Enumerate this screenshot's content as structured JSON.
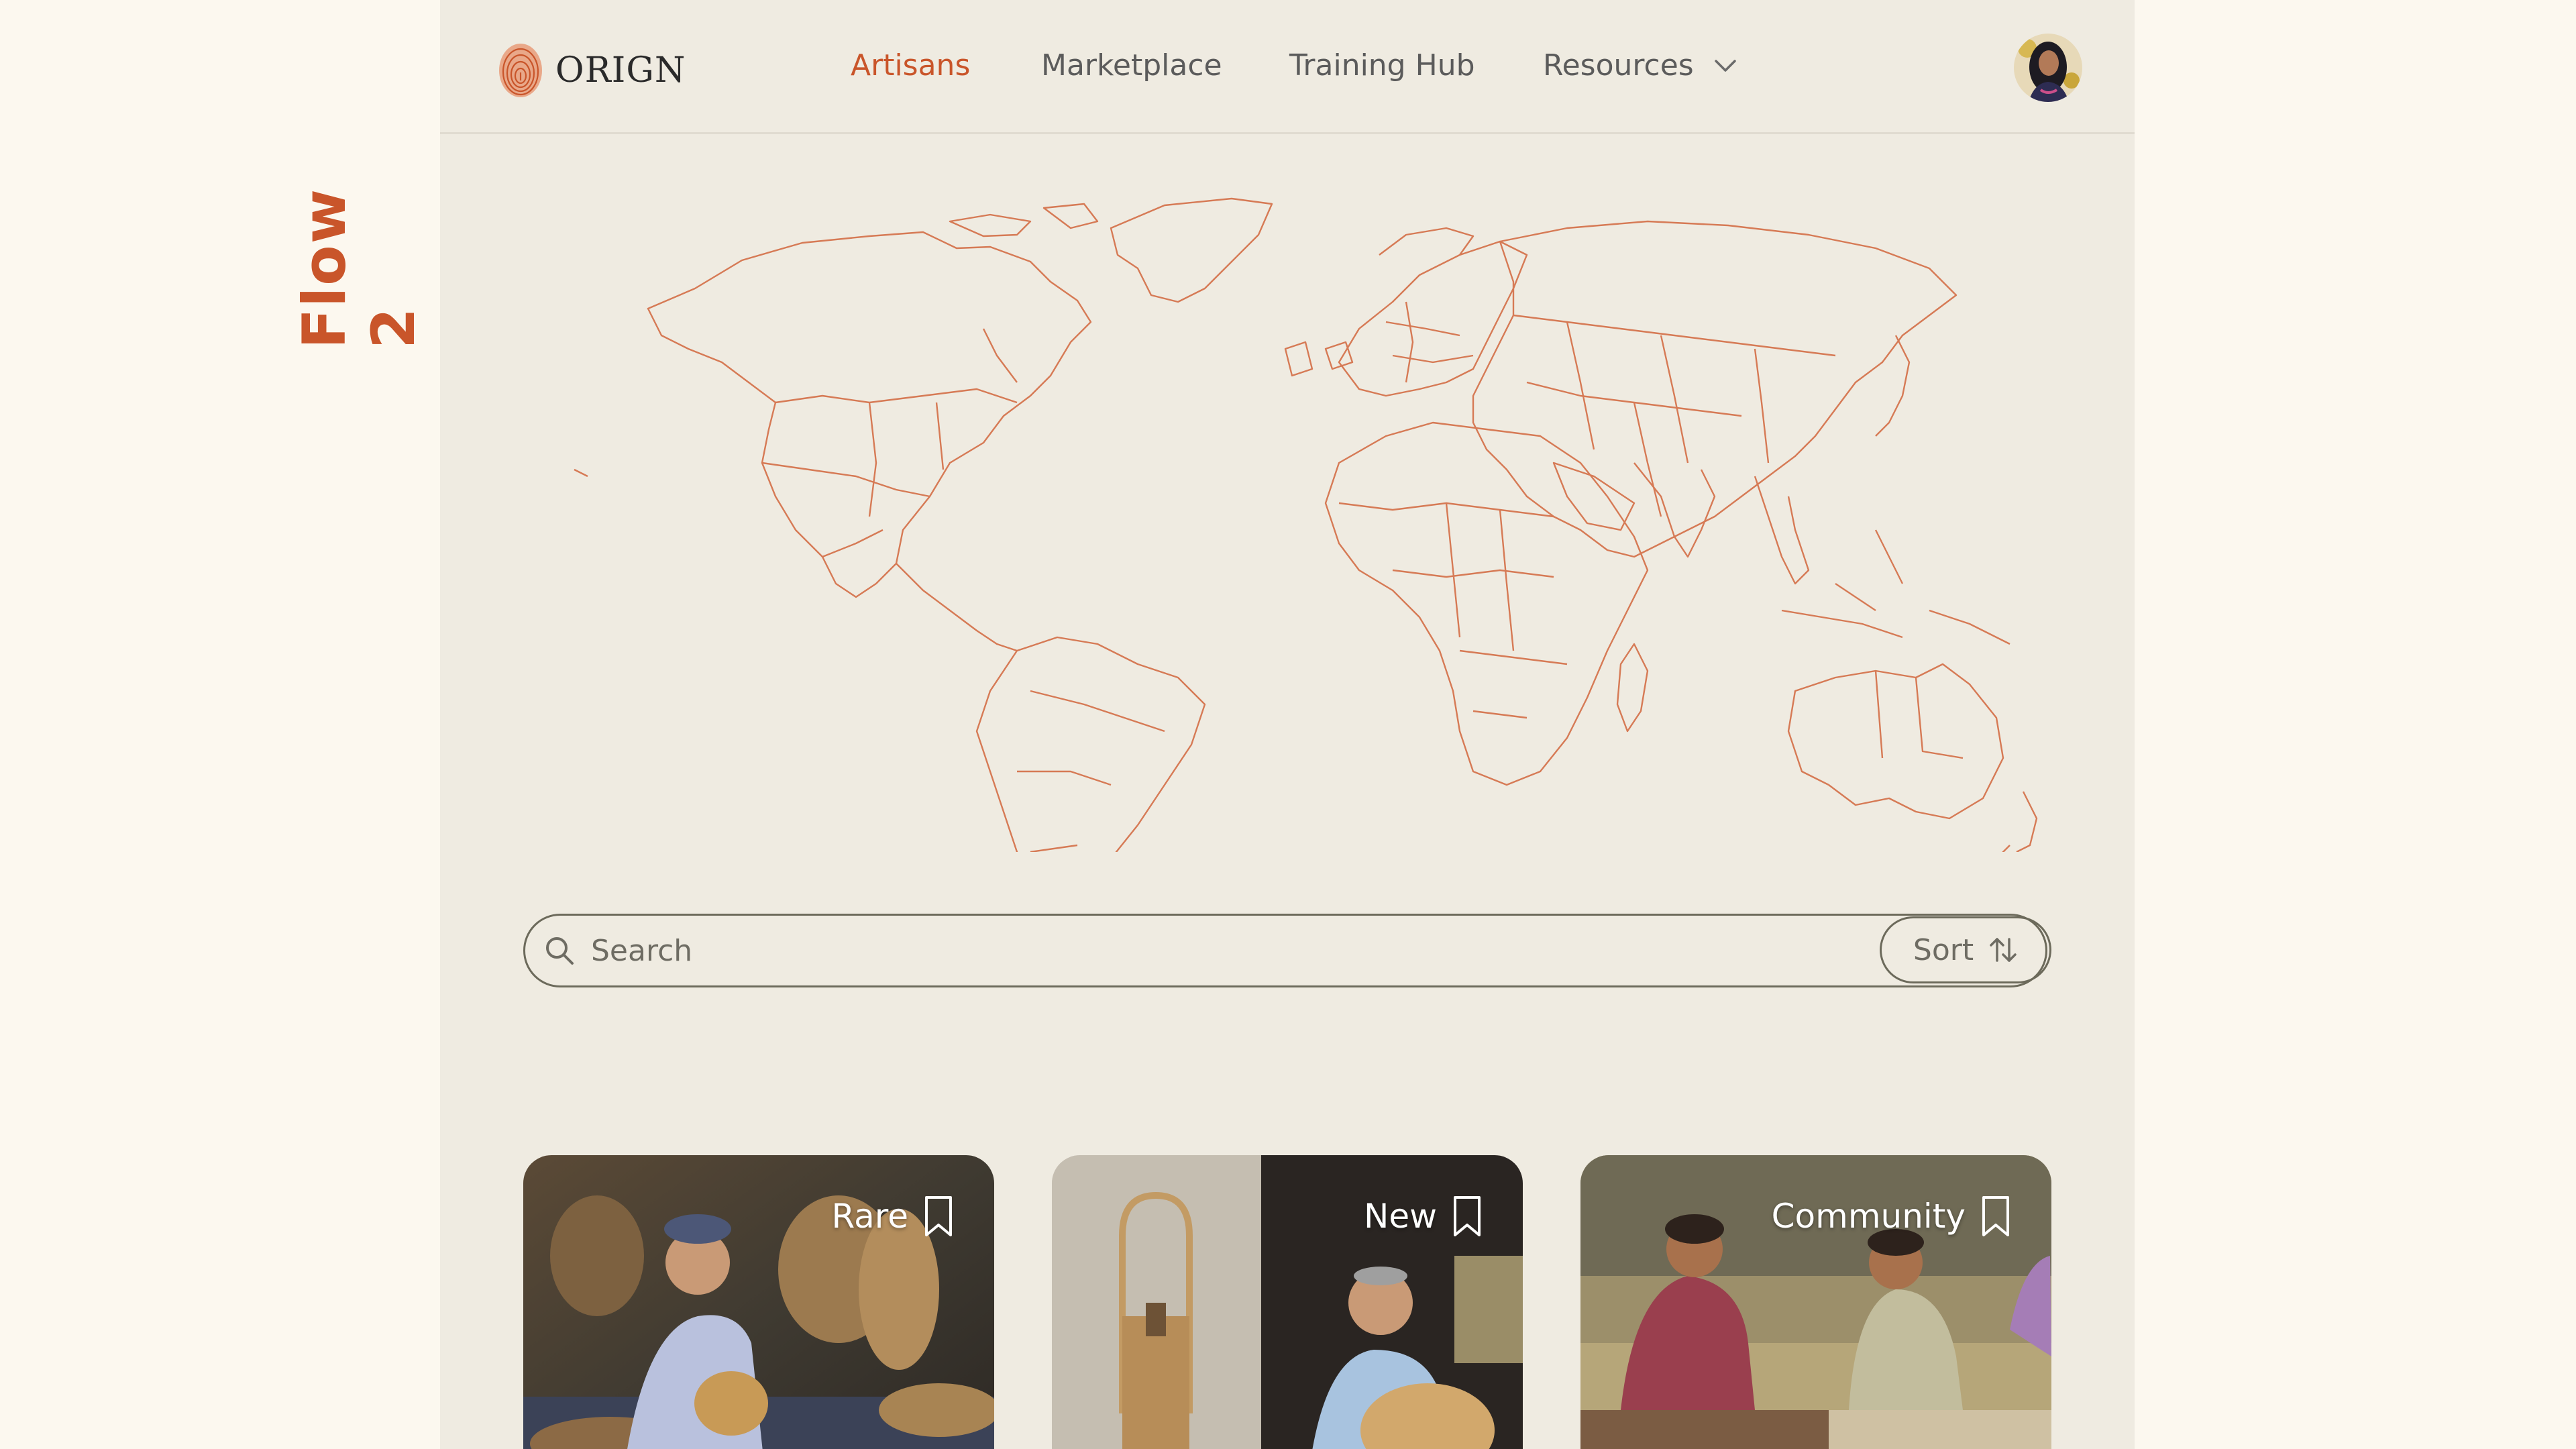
{
  "flow_label": "Flow 2",
  "brand": {
    "name": "ORIGN",
    "accent": "#c9552a"
  },
  "nav": {
    "artisans": "Artisans",
    "marketplace": "Marketplace",
    "training": "Training Hub",
    "resources": "Resources"
  },
  "search": {
    "placeholder": "Search"
  },
  "sort": {
    "label": "Sort"
  },
  "cards": [
    {
      "tag": "Rare"
    },
    {
      "tag": "New"
    },
    {
      "tag": "Community"
    }
  ],
  "icons": {
    "search": "search-icon",
    "sort": "sort-arrows-icon",
    "bookmark": "bookmark-icon",
    "chevron": "chevron-down-icon"
  }
}
